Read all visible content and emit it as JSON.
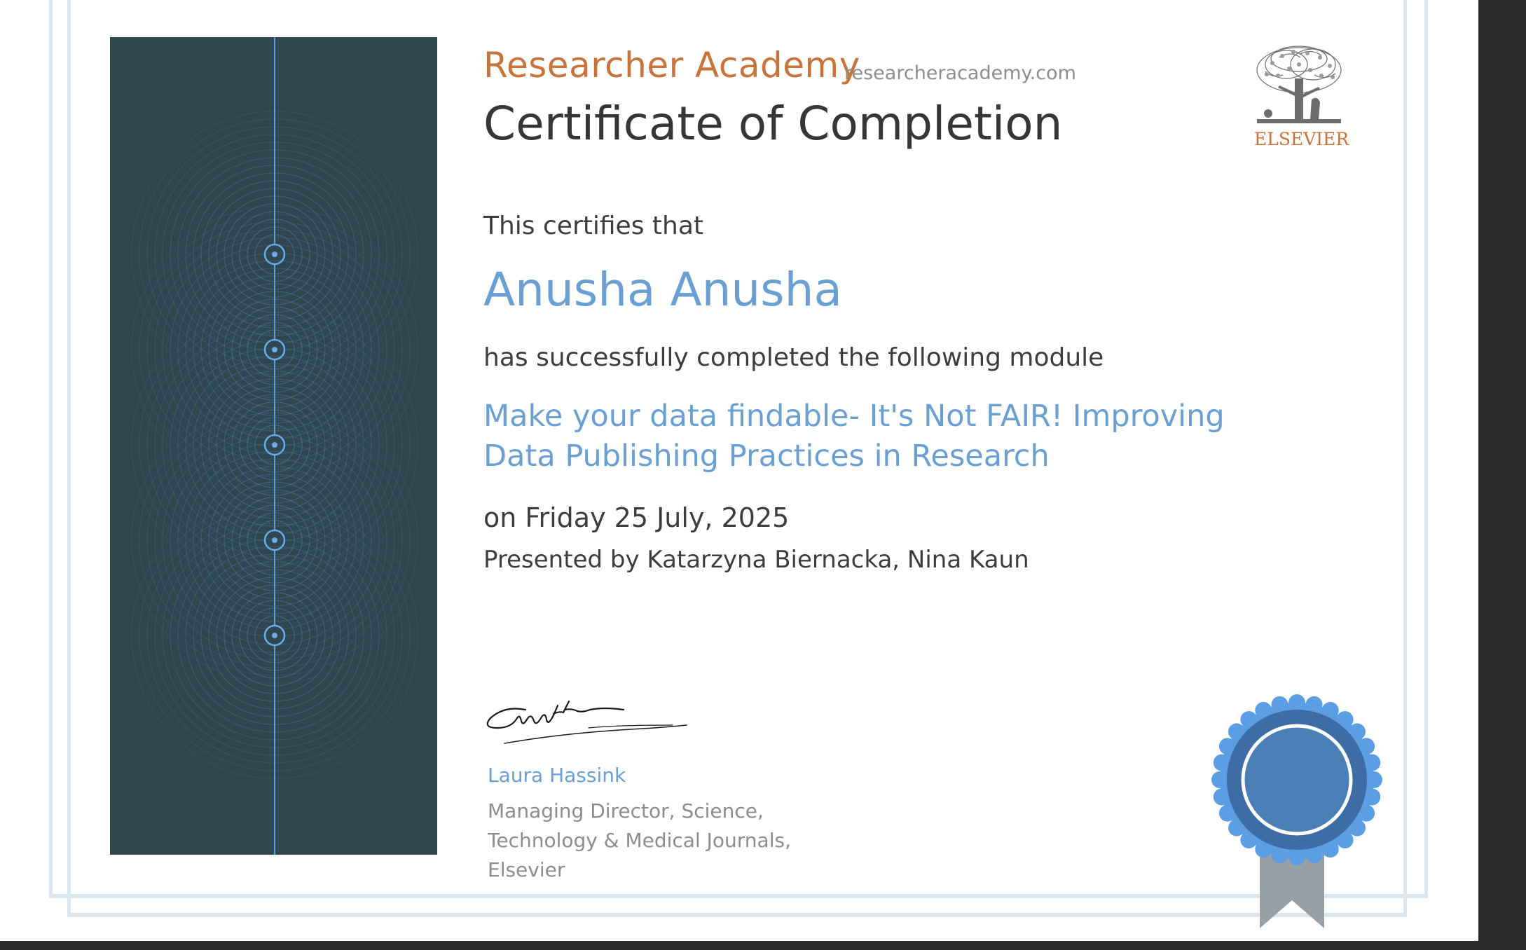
{
  "certificate": {
    "academy_name": "Researcher Academy",
    "academy_url": "researcheracademy.com",
    "title": "Certificate of Completion",
    "certifies_text": "This certifies that",
    "recipient_name": "Anusha Anusha",
    "completed_text": "has successfully completed the following module",
    "module_title": "Make your data findable- It's Not FAIR! Improving Data Publishing Practices in Research",
    "date_line": "on Friday 25 July, 2025",
    "presenters_line": "Presented by Katarzyna Biernacka, Nina Kaun"
  },
  "signatory": {
    "name": "Laura Hassink",
    "role": "Managing Director, Science, Technology & Medical Journals, Elsevier"
  },
  "branding": {
    "publisher_logo_text": "ELSEVIER",
    "logo_icon": "tree-logo-icon",
    "seal_icon": "award-ribbon-icon"
  },
  "colors": {
    "accent_orange": "#c8733a",
    "accent_blue": "#6a9fd4",
    "panel_dark": "#30474f",
    "seal_blue": "#4a7fb5",
    "ribbon_gray": "#97a0a5"
  }
}
